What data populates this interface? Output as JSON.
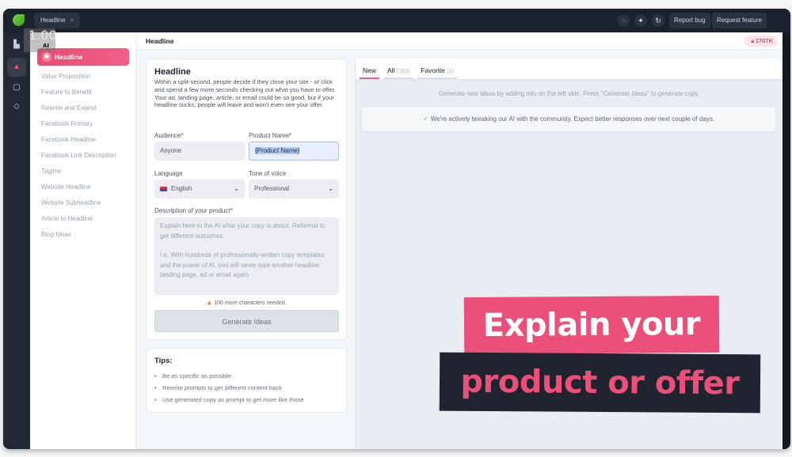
{
  "topbar": {
    "open_tab": {
      "label": "Headline",
      "close_icon": "×"
    },
    "icons": [
      "chat-icon",
      "sparkle-icon",
      "refresh-icon"
    ],
    "buttons": {
      "report_bug": "Report bug",
      "request_feature": "Request feature"
    }
  },
  "zoom_overlay": {
    "value": "1.00",
    "label": "AI"
  },
  "sidebar": {
    "active_item": "Headline",
    "items": [
      "Value Proposition",
      "Feature to Benefit",
      "Rewrite and Extend",
      "Facebook Primary",
      "Facebook Headline",
      "Facebook Link Description",
      "Tagline",
      "Website Headline",
      "Website Subheadline",
      "Article to Headline",
      "Blog Ideas"
    ]
  },
  "header": {
    "title": "Headline",
    "credits": "1707K"
  },
  "form": {
    "title": "Headline",
    "description": "Within a split-second, people decide if they close your site - or click and spend a few more seconds checking out what you have to offer. Your ad, landing page, article, or email could be so good, but if your headline sucks, people will leave and won't even see your offer.",
    "audience_label": "Audience*",
    "audience_value": "Anyone",
    "product_label": "Product Name*",
    "product_value": "{Product Name}",
    "language_label": "Language",
    "language_value": "English",
    "tone_label": "Tone of voice",
    "tone_value": "Professional",
    "description_label": "Description of your product*",
    "description_placeholder_1": "Explain here to the AI what your copy is about. Reformat to get different outcomes.",
    "description_placeholder_2": "I.e. With hundreds of professionally-written copy templates and the power of AI, you will never type another headline, landing page, ad or email again.",
    "warning": "100 more characters needed.",
    "generate_button": "Generate Ideas"
  },
  "tips": {
    "title": "Tips:",
    "items": [
      "Be as specific as possible",
      "Rewrite prompts to get different content back",
      "Use generated copy as prompt to get more like those"
    ]
  },
  "results": {
    "tabs": [
      {
        "label": "New",
        "count": ""
      },
      {
        "label": "All",
        "count": "(163)"
      },
      {
        "label": "Favorite",
        "count": "(1)"
      }
    ],
    "hint": "Generate new ideas by adding info on the left side. Press \"Generate Ideas\" to generate copy.",
    "notice": "We're actively tweaking our AI with the community. Expect better responses over next couple of days."
  },
  "promo": {
    "line1": "Explain your",
    "line2": "product or offer"
  },
  "colors": {
    "accent": "#ea5079",
    "dark": "#1f2430",
    "success": "#5bbf5b",
    "warning": "#f07a2e"
  }
}
